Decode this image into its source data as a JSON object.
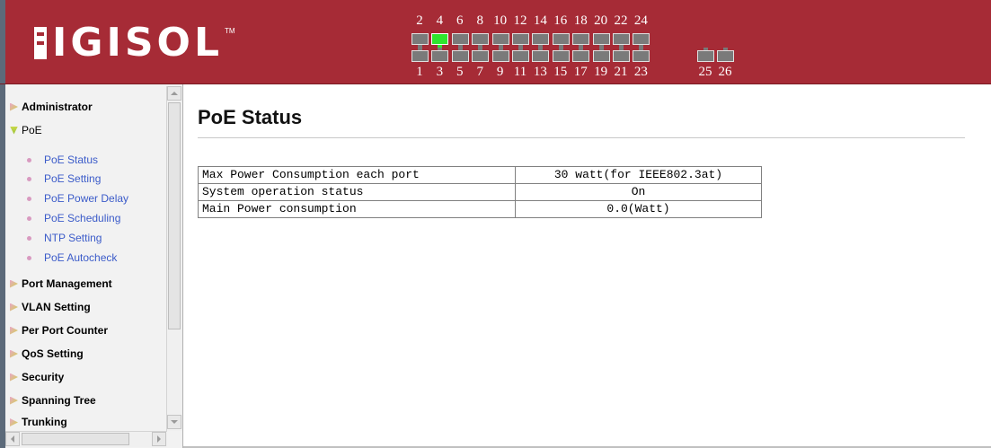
{
  "header": {
    "logo_text": "IGISOL",
    "logo_tm": "TM",
    "ports_top_numbers": [
      "2",
      "4",
      "6",
      "8",
      "10",
      "12",
      "14",
      "16",
      "18",
      "20",
      "22",
      "24"
    ],
    "ports_bottom_numbers": [
      "1",
      "3",
      "5",
      "7",
      "9",
      "11",
      "13",
      "15",
      "17",
      "19",
      "21",
      "23"
    ],
    "uplink_numbers": [
      "25",
      "26"
    ],
    "active_port": "4",
    "colors": {
      "brand": "#a62b36",
      "port_active": "#2ee62e",
      "port_idle": "#7a7a7a"
    }
  },
  "sidebar": {
    "items": [
      {
        "label": "Administrator",
        "state": "closed"
      },
      {
        "label": "PoE",
        "state": "open"
      },
      {
        "label": "Port Management",
        "state": "closed"
      },
      {
        "label": "VLAN Setting",
        "state": "closed"
      },
      {
        "label": "Per Port Counter",
        "state": "closed"
      },
      {
        "label": "QoS Setting",
        "state": "closed"
      },
      {
        "label": "Security",
        "state": "closed"
      },
      {
        "label": "Spanning Tree",
        "state": "closed"
      },
      {
        "label": "Trunking",
        "state": "closed"
      }
    ],
    "poe_subitems": [
      {
        "label": "PoE Status"
      },
      {
        "label": "PoE Setting"
      },
      {
        "label": "PoE Power Delay"
      },
      {
        "label": "PoE Scheduling"
      },
      {
        "label": "NTP Setting"
      },
      {
        "label": "PoE Autocheck"
      }
    ]
  },
  "main": {
    "title": "PoE Status",
    "rows": [
      {
        "label": "Max Power Consumption each port",
        "value": "30 watt(for IEEE802.3at)"
      },
      {
        "label": "System operation status",
        "value": "On"
      },
      {
        "label": "Main Power consumption",
        "value": "0.0(Watt)"
      }
    ]
  }
}
